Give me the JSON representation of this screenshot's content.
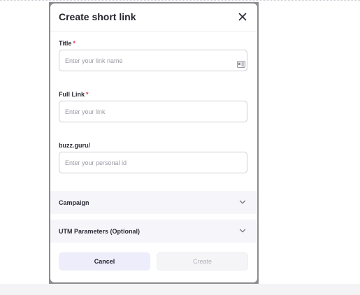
{
  "modal": {
    "title": "Create short link",
    "close_icon": "close-icon"
  },
  "fields": {
    "title": {
      "label": "Title",
      "required_mark": "*",
      "placeholder": "Enter your link name",
      "value": "",
      "icon": "id-card-icon"
    },
    "full_link": {
      "label": "Full Link",
      "required_mark": "*",
      "placeholder": "Enter your link",
      "value": ""
    },
    "personal_id": {
      "label": "buzz.guru/",
      "placeholder": "Enter your personal id",
      "value": ""
    }
  },
  "sections": [
    {
      "label": "Campaign",
      "icon": "chevron-down-icon"
    },
    {
      "label": "UTM Parameters (Optional)",
      "icon": "chevron-down-icon"
    }
  ],
  "actions": {
    "cancel_label": "Cancel",
    "create_label": "Create"
  },
  "colors": {
    "required": "#e0354b",
    "cancel_bg": "#eeedfb",
    "create_disabled_bg": "#f5f5f7",
    "section_bg": "#f6f6fa"
  }
}
